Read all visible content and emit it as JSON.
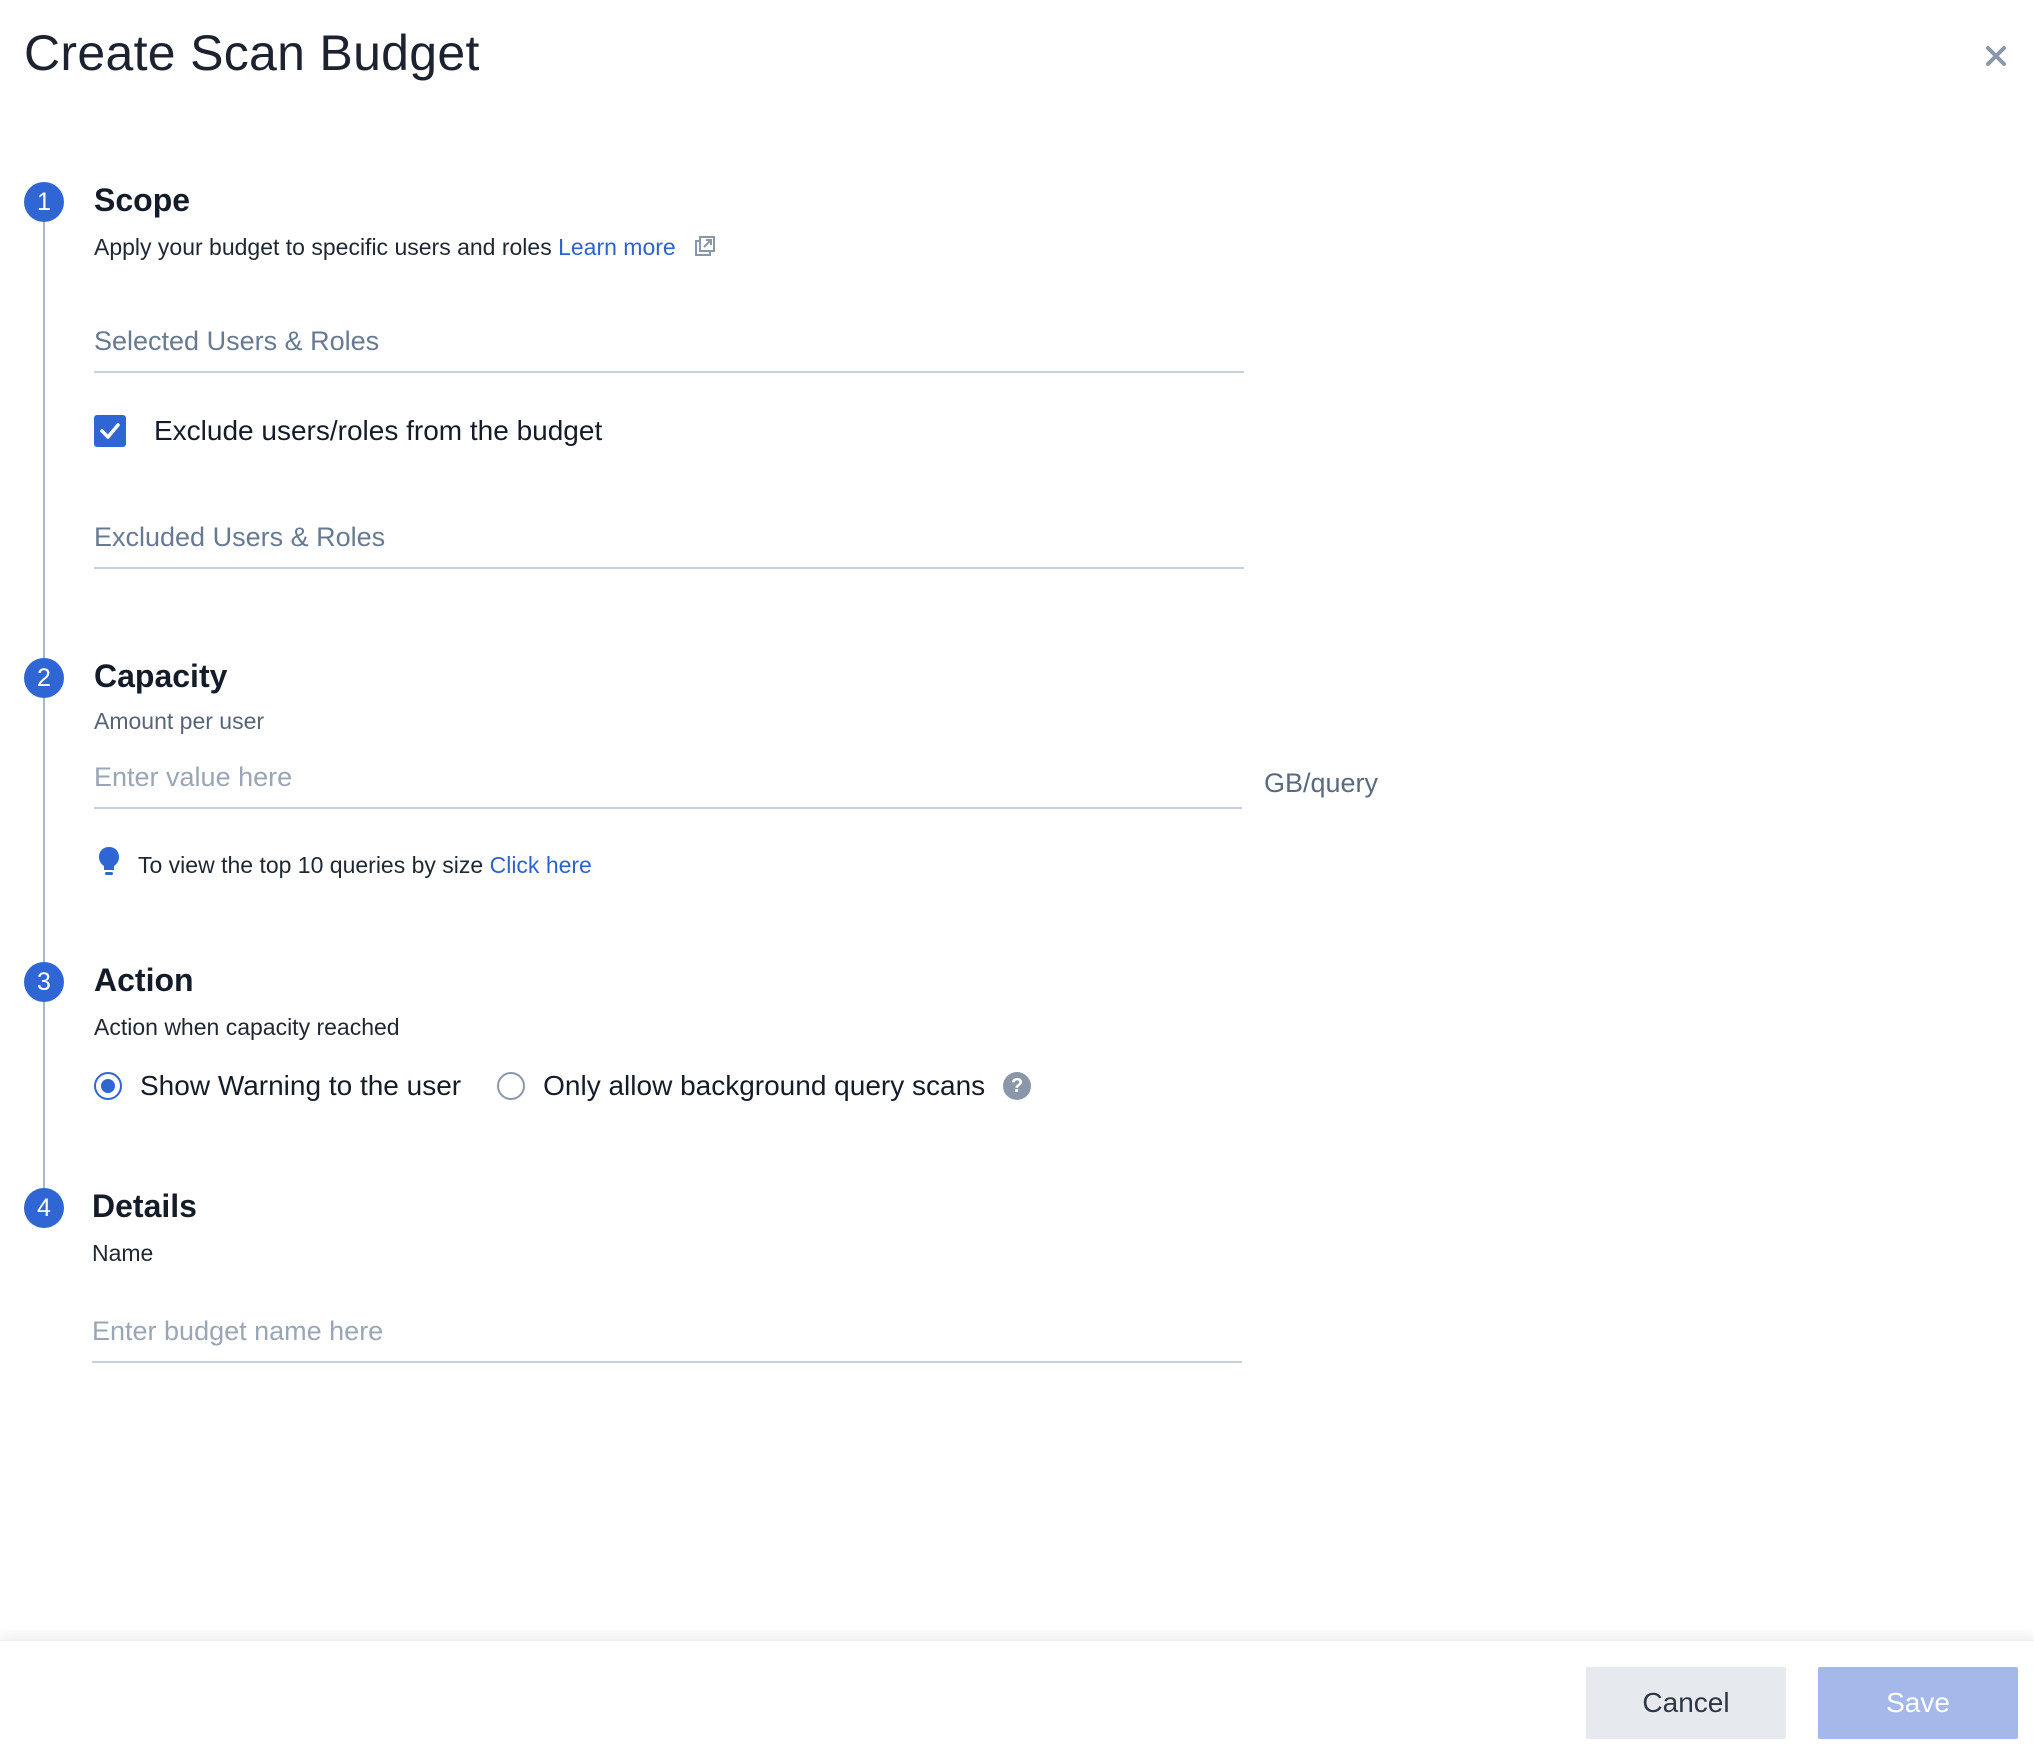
{
  "dialog": {
    "title": "Create Scan Budget"
  },
  "steps": [
    {
      "number": "1",
      "title": "Scope"
    },
    {
      "number": "2",
      "title": "Capacity"
    },
    {
      "number": "3",
      "title": "Action"
    },
    {
      "number": "4",
      "title": "Details"
    }
  ],
  "scope": {
    "description": "Apply your budget to specific users and roles",
    "learn_more": "Learn more",
    "selected_placeholder": "Selected Users & Roles",
    "exclude_checkbox_label": "Exclude users/roles from the budget",
    "exclude_checked": true,
    "excluded_placeholder": "Excluded Users & Roles"
  },
  "capacity": {
    "label": "Amount per user",
    "placeholder": "Enter value here",
    "unit": "GB/query",
    "tip_text": "To view the top 10 queries by size",
    "tip_link": "Click here"
  },
  "action": {
    "label": "Action when capacity reached",
    "options": [
      {
        "label": "Show Warning to the user",
        "selected": true
      },
      {
        "label": "Only allow background query scans",
        "selected": false
      }
    ],
    "help": "?"
  },
  "details": {
    "name_label": "Name",
    "name_placeholder": "Enter budget name here"
  },
  "footer": {
    "cancel": "Cancel",
    "save": "Save"
  },
  "colors": {
    "accent": "#2f66d4",
    "link": "#2c63d1",
    "save_disabled": "#a4b9ea",
    "cancel_bg": "#e6e9ed"
  },
  "icons": {
    "close": "close-icon",
    "external_link": "external-link-icon",
    "checkbox": "checkmark-icon",
    "tip": "lightbulb-icon",
    "help": "question-circle-icon"
  }
}
